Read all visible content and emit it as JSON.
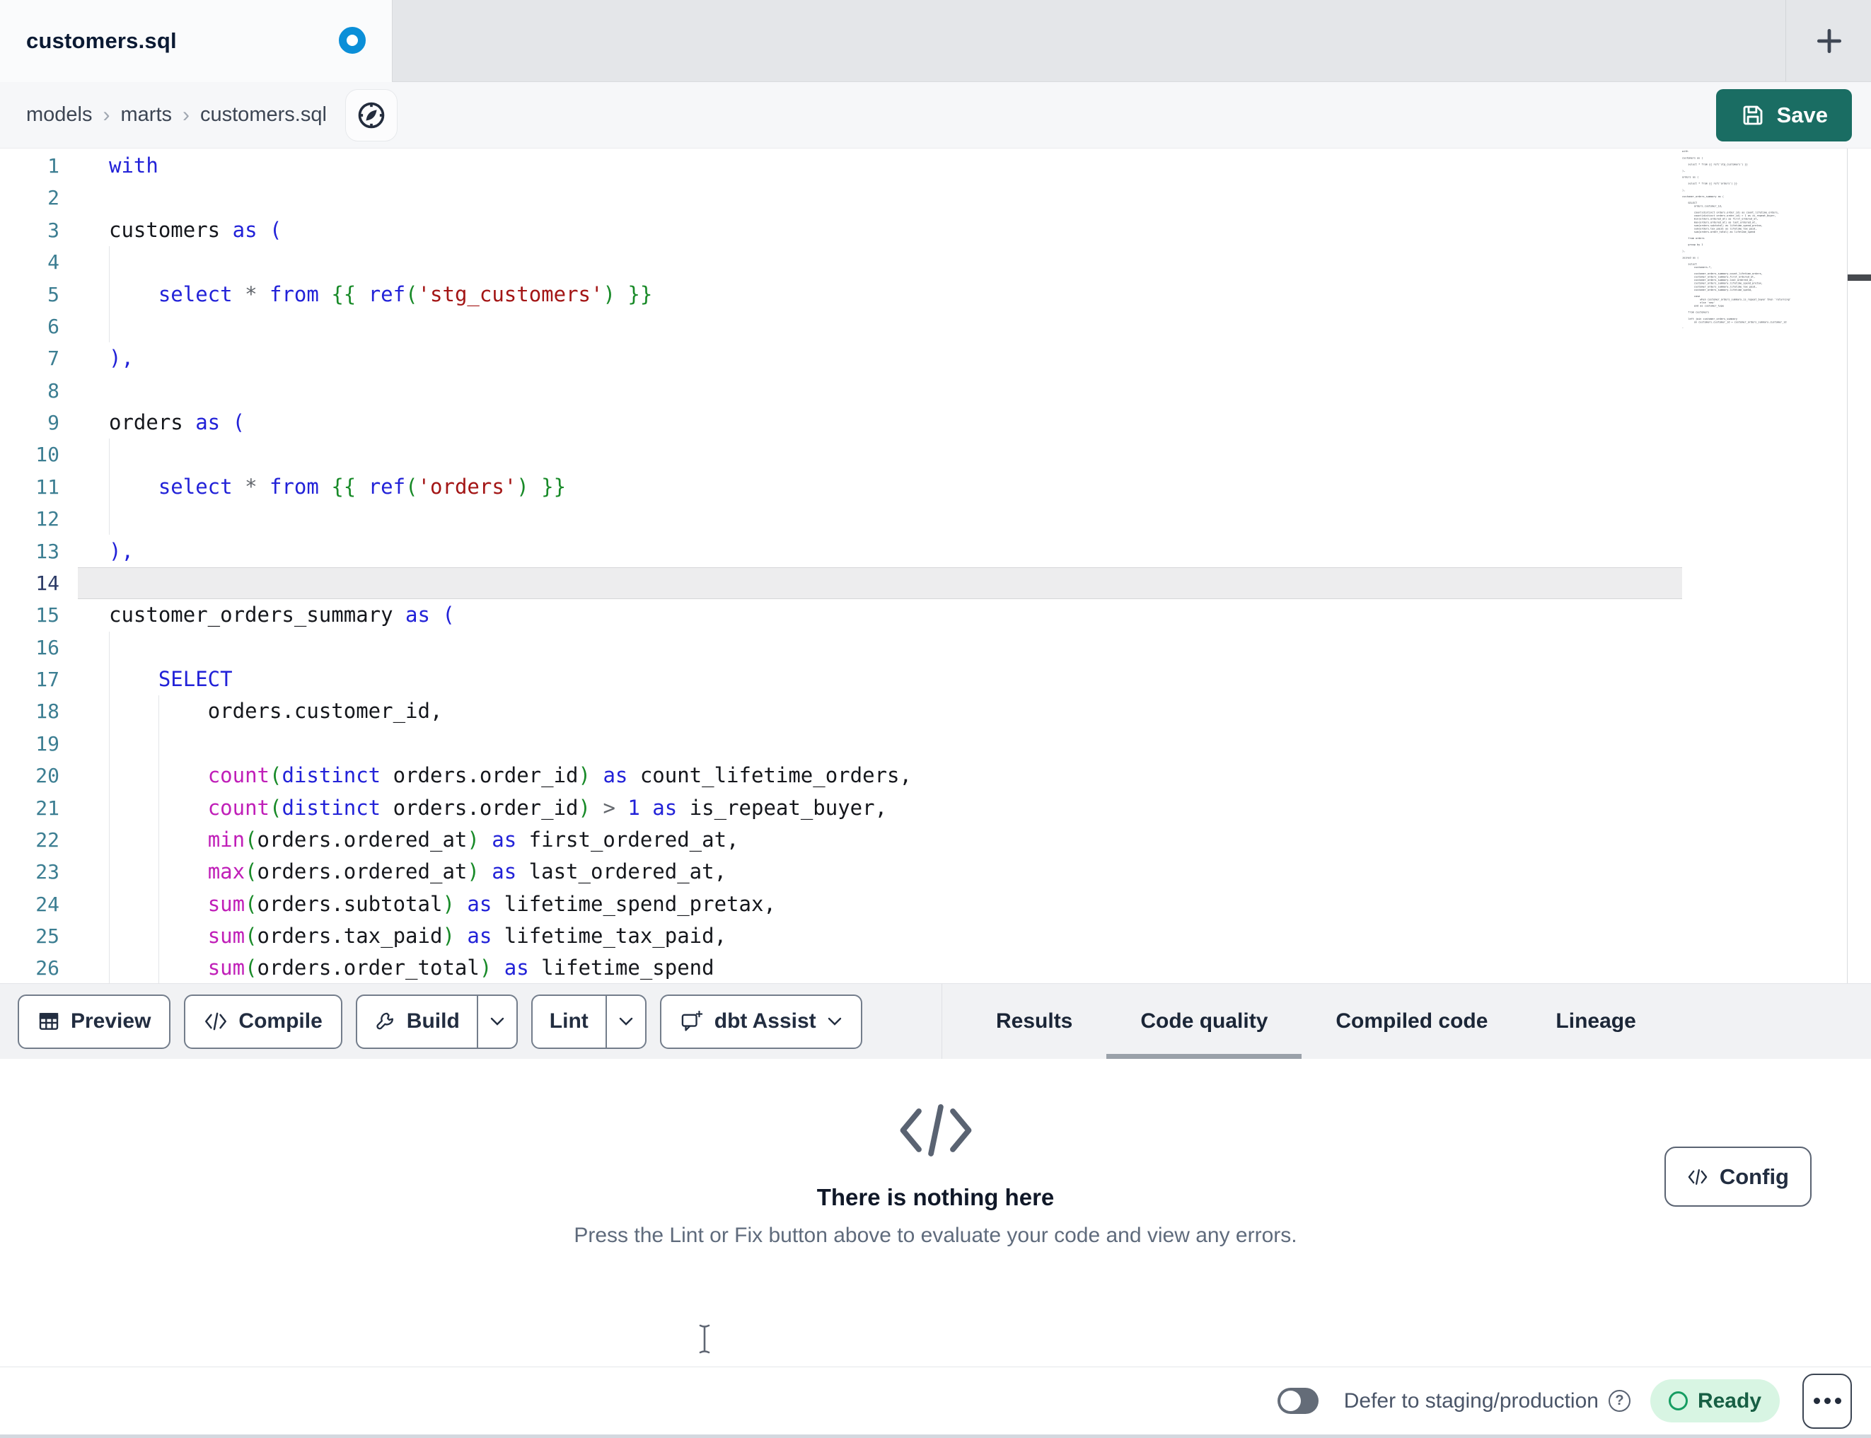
{
  "tabbar": {
    "tab_title": "customers.sql",
    "unsaved": true,
    "new_tab": "+"
  },
  "breadcrumb": {
    "items": [
      "models",
      "marts",
      "customers.sql"
    ],
    "separator": "›"
  },
  "save": {
    "label": "Save"
  },
  "editor": {
    "active_line": 14,
    "lines": [
      {
        "n": 1,
        "t": [
          [
            "kw",
            "with"
          ]
        ]
      },
      {
        "n": 2,
        "t": []
      },
      {
        "n": 3,
        "t": [
          [
            "id",
            "customers "
          ],
          [
            "kw",
            "as ("
          ]
        ]
      },
      {
        "n": 4,
        "t": []
      },
      {
        "n": 5,
        "t": [
          [
            "ws",
            "    "
          ],
          [
            "kw",
            "select"
          ],
          [
            "op",
            " * "
          ],
          [
            "kw",
            "from"
          ],
          [
            "ws",
            " "
          ],
          [
            "grn",
            "{{ "
          ],
          [
            "kw",
            "ref"
          ],
          [
            "grn",
            "("
          ],
          [
            "str",
            "'stg_customers'"
          ],
          [
            "grn",
            ") }}"
          ]
        ]
      },
      {
        "n": 6,
        "t": []
      },
      {
        "n": 7,
        "t": [
          [
            "kw",
            "),"
          ]
        ]
      },
      {
        "n": 8,
        "t": []
      },
      {
        "n": 9,
        "t": [
          [
            "id",
            "orders "
          ],
          [
            "kw",
            "as ("
          ]
        ]
      },
      {
        "n": 10,
        "t": []
      },
      {
        "n": 11,
        "t": [
          [
            "ws",
            "    "
          ],
          [
            "kw",
            "select"
          ],
          [
            "op",
            " * "
          ],
          [
            "kw",
            "from"
          ],
          [
            "ws",
            " "
          ],
          [
            "grn",
            "{{ "
          ],
          [
            "kw",
            "ref"
          ],
          [
            "grn",
            "("
          ],
          [
            "str",
            "'orders'"
          ],
          [
            "grn",
            ") }}"
          ]
        ]
      },
      {
        "n": 12,
        "t": []
      },
      {
        "n": 13,
        "t": [
          [
            "kw",
            "),"
          ]
        ]
      },
      {
        "n": 14,
        "t": []
      },
      {
        "n": 15,
        "t": [
          [
            "id",
            "customer_orders_summary "
          ],
          [
            "kw",
            "as ("
          ]
        ]
      },
      {
        "n": 16,
        "t": []
      },
      {
        "n": 17,
        "t": [
          [
            "ws",
            "    "
          ],
          [
            "kw",
            "SELECT"
          ]
        ]
      },
      {
        "n": 18,
        "t": [
          [
            "ws",
            "        "
          ],
          [
            "id",
            "orders.customer_id,"
          ]
        ]
      },
      {
        "n": 19,
        "t": []
      },
      {
        "n": 20,
        "t": [
          [
            "ws",
            "        "
          ],
          [
            "fn",
            "count"
          ],
          [
            "grn",
            "("
          ],
          [
            "kw",
            "distinct"
          ],
          [
            "id",
            " orders.order_id"
          ],
          [
            "grn",
            ")"
          ],
          [
            "kw",
            " as"
          ],
          [
            "id",
            " count_lifetime_orders,"
          ]
        ]
      },
      {
        "n": 21,
        "t": [
          [
            "ws",
            "        "
          ],
          [
            "fn",
            "count"
          ],
          [
            "grn",
            "("
          ],
          [
            "kw",
            "distinct"
          ],
          [
            "id",
            " orders.order_id"
          ],
          [
            "grn",
            ")"
          ],
          [
            "op",
            " > "
          ],
          [
            "num",
            "1"
          ],
          [
            "kw",
            " as"
          ],
          [
            "id",
            " is_repeat_buyer,"
          ]
        ]
      },
      {
        "n": 22,
        "t": [
          [
            "ws",
            "        "
          ],
          [
            "fn",
            "min"
          ],
          [
            "grn",
            "("
          ],
          [
            "id",
            "orders.ordered_at"
          ],
          [
            "grn",
            ")"
          ],
          [
            "kw",
            " as"
          ],
          [
            "id",
            " first_ordered_at,"
          ]
        ]
      },
      {
        "n": 23,
        "t": [
          [
            "ws",
            "        "
          ],
          [
            "fn",
            "max"
          ],
          [
            "grn",
            "("
          ],
          [
            "id",
            "orders.ordered_at"
          ],
          [
            "grn",
            ")"
          ],
          [
            "kw",
            " as"
          ],
          [
            "id",
            " last_ordered_at,"
          ]
        ]
      },
      {
        "n": 24,
        "t": [
          [
            "ws",
            "        "
          ],
          [
            "fn",
            "sum"
          ],
          [
            "grn",
            "("
          ],
          [
            "id",
            "orders.subtotal"
          ],
          [
            "grn",
            ")"
          ],
          [
            "kw",
            " as"
          ],
          [
            "id",
            " lifetime_spend_pretax,"
          ]
        ]
      },
      {
        "n": 25,
        "t": [
          [
            "ws",
            "        "
          ],
          [
            "fn",
            "sum"
          ],
          [
            "grn",
            "("
          ],
          [
            "id",
            "orders.tax_paid"
          ],
          [
            "grn",
            ")"
          ],
          [
            "kw",
            " as"
          ],
          [
            "id",
            " lifetime_tax_paid,"
          ]
        ]
      },
      {
        "n": 26,
        "t": [
          [
            "ws",
            "        "
          ],
          [
            "fn",
            "sum"
          ],
          [
            "grn",
            "("
          ],
          [
            "id",
            "orders.order_total"
          ],
          [
            "grn",
            ")"
          ],
          [
            "kw",
            " as"
          ],
          [
            "id",
            " lifetime_spend"
          ]
        ]
      }
    ],
    "minimap_lines": [
      "with",
      "",
      "customers as (",
      "",
      "    select * from {{ ref('stg_customers') }}",
      "",
      "),",
      "",
      "orders as (",
      "",
      "    select * from {{ ref('orders') }}",
      "",
      "),",
      "",
      "customer_orders_summary as (",
      "",
      "    SELECT",
      "        orders.customer_id,",
      "",
      "        count(distinct orders.order_id) as count_lifetime_orders,",
      "        count(distinct orders.order_id) > 1 as is_repeat_buyer,",
      "        min(orders.ordered_at) as first_ordered_at,",
      "        max(orders.ordered_at) as last_ordered_at,",
      "        sum(orders.subtotal) as lifetime_spend_pretax,",
      "        sum(orders.tax_paid) as lifetime_tax_paid,",
      "        sum(orders.order_total) as lifetime_spend",
      "",
      "    from orders",
      "",
      "    group by 1",
      "",
      "),",
      "",
      "joined as (",
      "",
      "    select",
      "        customers.*,",
      "",
      "        customer_orders_summary.count_lifetime_orders,",
      "        customer_orders_summary.first_ordered_at,",
      "        customer_orders_summary.last_ordered_at,",
      "        customer_orders_summary.lifetime_spend_pretax,",
      "        customer_orders_summary.lifetime_tax_paid,",
      "        customer_orders_summary.lifetime_spend,",
      "",
      "        case",
      "            when customer_orders_summary.is_repeat_buyer then 'returning'",
      "            else 'new'",
      "        end as customer_type",
      "",
      "    from customers",
      "",
      "    left join customer_orders_summary",
      "        on customers.customer_id = customer_orders_summary.customer_id",
      "",
      ")",
      "",
      "select * from joined"
    ]
  },
  "toolbar": {
    "preview": "Preview",
    "compile": "Compile",
    "build": "Build",
    "lint": "Lint",
    "assist": "dbt Assist"
  },
  "result_tabs": [
    {
      "label": "Results",
      "active": false
    },
    {
      "label": "Code quality",
      "active": true
    },
    {
      "label": "Compiled code",
      "active": false
    },
    {
      "label": "Lineage",
      "active": false
    }
  ],
  "panel": {
    "title": "There is nothing here",
    "subtitle": "Press the Lint or Fix button above to evaluate your code and view any errors.",
    "config_label": "Config"
  },
  "statusbar": {
    "defer_label": "Defer to staging/production",
    "ready_label": "Ready"
  },
  "colors": {
    "accent": "#1a6d63",
    "unsaved_dot": "#0b8fd8",
    "ready_bg": "#d8f5e3",
    "ready_text": "#175f44",
    "keyword": "#2222d8",
    "function": "#c01fb8",
    "string": "#a31515",
    "jinja": "#188a28",
    "line_number": "#3c7e92"
  }
}
